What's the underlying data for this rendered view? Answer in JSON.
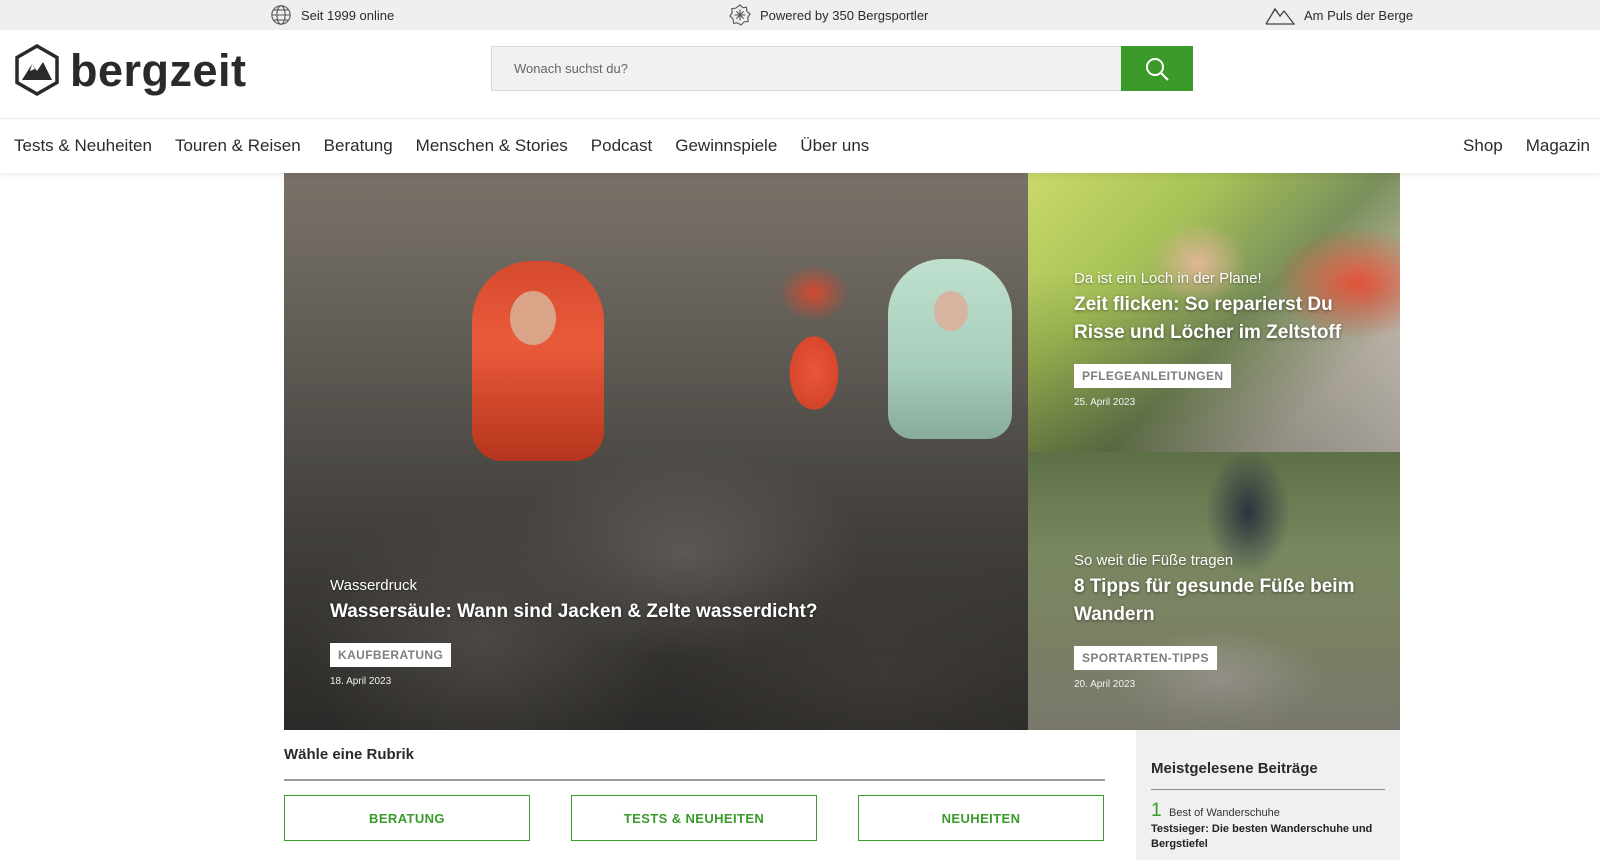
{
  "colors": {
    "accent": "#3a9a2a",
    "topbar_bg": "#efefef"
  },
  "topbar": {
    "items": [
      {
        "icon": "globe-icon",
        "text": "Seit 1999 online"
      },
      {
        "icon": "badge-icon",
        "text": "Powered by 350 Bergsportler"
      },
      {
        "icon": "mountain-icon",
        "text": "Am Puls der Berge"
      }
    ]
  },
  "header": {
    "logo_text": "bergzeit",
    "search": {
      "placeholder": "Wonach suchst du?",
      "button_icon": "search-icon"
    }
  },
  "nav": {
    "main": [
      "Tests & Neuheiten",
      "Touren & Reisen",
      "Beratung",
      "Menschen & Stories",
      "Podcast",
      "Gewinnspiele",
      "Über uns"
    ],
    "right": [
      "Shop",
      "Magazin"
    ]
  },
  "hero": {
    "main": {
      "kicker": "Wasserdruck",
      "title": "Wassersäule: Wann sind Jacken & Zelte wasserdicht?",
      "tag": "KAUFBERATUNG",
      "date": "18. April 2023"
    },
    "top": {
      "kicker": "Da ist ein Loch in der Plane!",
      "title": "Zeit flicken: So reparierst Du Risse und Löcher im Zeltstoff",
      "tag": "PFLEGEANLEITUNGEN",
      "date": "25. April 2023"
    },
    "bottom": {
      "kicker": "So weit die Füße tragen",
      "title": "8 Tipps für gesunde Füße beim Wandern",
      "tag": "SPORTARTEN-TIPPS",
      "date": "20. April 2023"
    }
  },
  "rubrik": {
    "title": "Wähle eine Rubrik",
    "buttons": [
      "BERATUNG",
      "TESTS & NEUHEITEN",
      "NEUHEITEN"
    ]
  },
  "mostread": {
    "title": "Meistgelesene Beiträge",
    "items": [
      {
        "rank": "1",
        "kicker": "Best of Wanderschuhe",
        "title": "Testsieger: Die besten Wanderschuhe und Bergstiefel"
      }
    ]
  }
}
